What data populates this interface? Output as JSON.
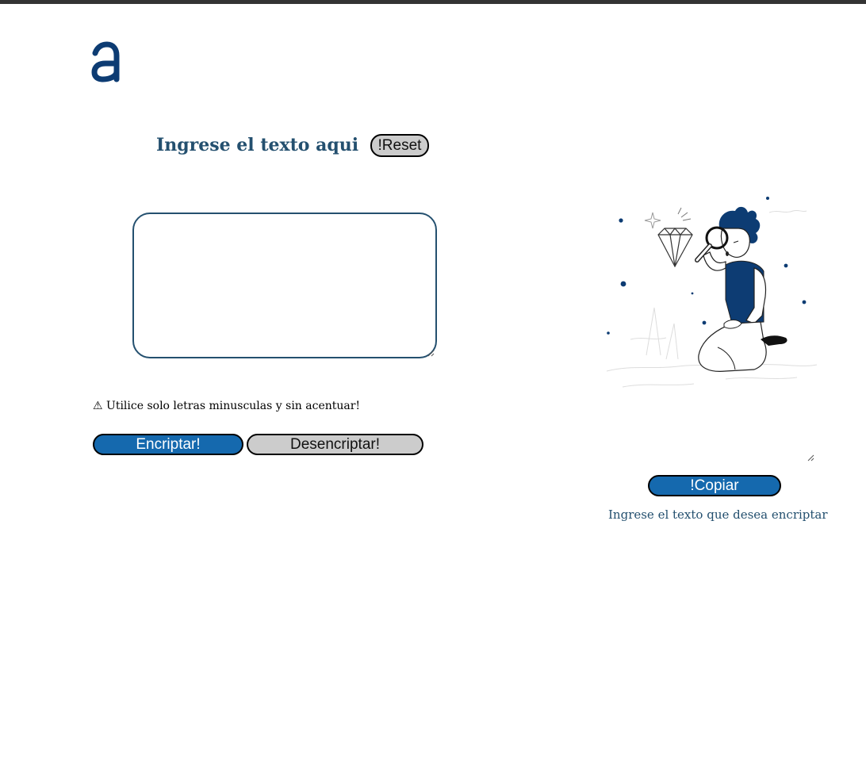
{
  "colors": {
    "brand_blue": "#1569ae",
    "logo_navy": "#0d3c73",
    "heading_blue": "#24506f",
    "neutral_button": "#cccccc"
  },
  "logo": {
    "icon": "alura-a-logo-icon"
  },
  "input_panel": {
    "heading": "Ingrese el texto aqui",
    "reset_label": "!Reset",
    "input_value": "",
    "warning_icon": "⚠",
    "warning_text": "Utilice solo letras minusculas y sin acentuar!",
    "encrypt_label": "Encriptar!",
    "decrypt_label": "Desencriptar!"
  },
  "output_panel": {
    "illustration": "person-with-magnifying-glass-illustration",
    "copy_label": "!Copiar",
    "hint_text": "Ingrese el texto que desea encriptar"
  }
}
